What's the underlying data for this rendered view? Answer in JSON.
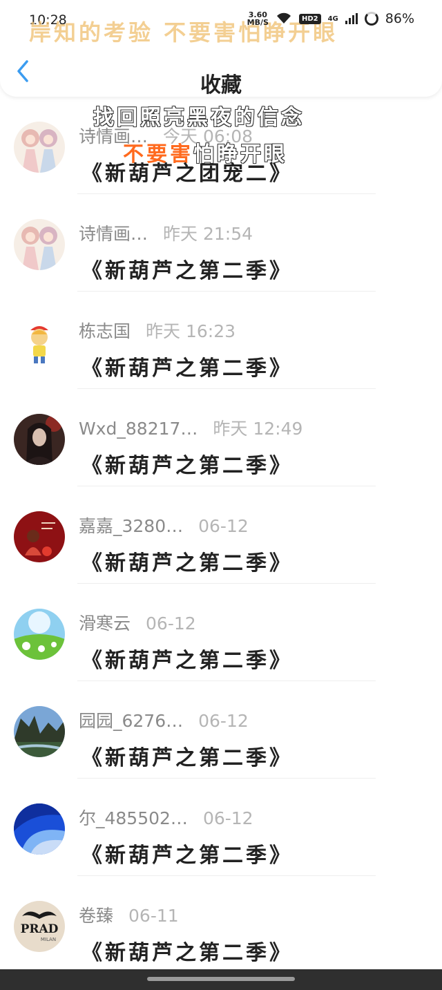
{
  "status_bar": {
    "time": "10:28",
    "net_speed_value": "3.60",
    "net_speed_unit": "MB/S",
    "hd_badge": "HD2",
    "network_type": "4G",
    "battery": "86%"
  },
  "overlay": {
    "line1": "岸知的考验 不要害怕睁开眼",
    "line2": "找回照亮黑夜的信念",
    "line3_a": "不要害",
    "line3_b": "怕睁开眼"
  },
  "header": {
    "back_icon": "chevron-left-icon",
    "title": "收藏"
  },
  "items": [
    {
      "author": "诗情画…",
      "time": "今天 06:08",
      "title": "《新葫芦之团宠二》",
      "avatar": "anime-twins"
    },
    {
      "author": "诗情画…",
      "time": "昨天 21:54",
      "title": "《新葫芦之第二季》",
      "avatar": "anime-twins"
    },
    {
      "author": "栋志国",
      "time": "昨天 16:23",
      "title": "《新葫芦之第二季》",
      "avatar": "cartoon-boy"
    },
    {
      "author": "Wxd_88217…",
      "time": "昨天 12:49",
      "title": "《新葫芦之第二季》",
      "avatar": "dark-portrait"
    },
    {
      "author": "嘉嘉_3280…",
      "time": "06-12",
      "title": "《新葫芦之第二季》",
      "avatar": "red-card"
    },
    {
      "author": "滑寒云",
      "time": "06-12",
      "title": "《新葫芦之第二季》",
      "avatar": "meadow-dandelion"
    },
    {
      "author": "园园_6276…",
      "time": "06-12",
      "title": "《新葫芦之第二季》",
      "avatar": "lake-cliffs"
    },
    {
      "author": "尔_485502…",
      "time": "06-12",
      "title": "《新葫芦之第二季》",
      "avatar": "blue-abstract"
    },
    {
      "author": "卷臻",
      "time": "06-11",
      "title": "《新葫芦之第二季》",
      "avatar": "prada-mustache"
    }
  ],
  "avatar_text": {
    "prada": "PRAD",
    "milan": "MILAN"
  },
  "colors": {
    "accent": "#3b9cf0",
    "overlay_yellow": "#f0c070",
    "overlay_orange": "#ff6a1e"
  }
}
